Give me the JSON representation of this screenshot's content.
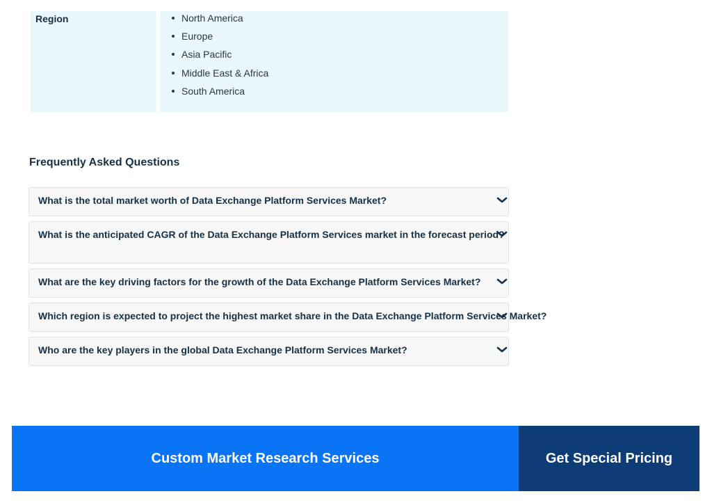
{
  "region": {
    "label": "Region",
    "items": [
      "North America",
      "Europe",
      "Asia Pacific",
      "Middle East & Africa",
      "South America"
    ]
  },
  "faq": {
    "title": "Frequently Asked Questions",
    "chevron_icon": "chevron-down-icon",
    "items": [
      {
        "question": "What is the total market worth of Data Exchange Platform Services Market?"
      },
      {
        "question": "What is the anticipated CAGR of the Data Exchange Platform Services market in the forecast period?"
      },
      {
        "question": "What are the key driving factors for the growth of the Data Exchange Platform Services Market?"
      },
      {
        "question": "Which region is expected to project the highest market share in the Data Exchange Platform Services Market?"
      },
      {
        "question": "Who are the key players in the global Data Exchange Platform Services Market?"
      }
    ]
  },
  "banner": {
    "left_label": "Custom Market Research Services",
    "right_label": "Get Special Pricing",
    "left_color": "#0a74f6",
    "right_color": "#0d3c76"
  }
}
